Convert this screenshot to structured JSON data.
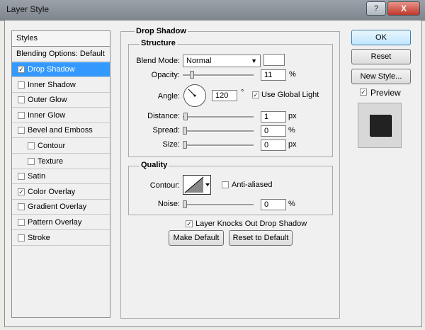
{
  "window": {
    "title": "Layer Style",
    "help_button": "?",
    "close_button": "X"
  },
  "styles": {
    "header": "Styles",
    "blending_options": "Blending Options: Default",
    "items": [
      {
        "label": "Drop Shadow",
        "checked": true,
        "selected": true,
        "indent": false
      },
      {
        "label": "Inner Shadow",
        "checked": false,
        "selected": false,
        "indent": false
      },
      {
        "label": "Outer Glow",
        "checked": false,
        "selected": false,
        "indent": false
      },
      {
        "label": "Inner Glow",
        "checked": false,
        "selected": false,
        "indent": false
      },
      {
        "label": "Bevel and Emboss",
        "checked": false,
        "selected": false,
        "indent": false
      },
      {
        "label": "Contour",
        "checked": false,
        "selected": false,
        "indent": true
      },
      {
        "label": "Texture",
        "checked": false,
        "selected": false,
        "indent": true
      },
      {
        "label": "Satin",
        "checked": false,
        "selected": false,
        "indent": false
      },
      {
        "label": "Color Overlay",
        "checked": true,
        "selected": false,
        "indent": false
      },
      {
        "label": "Gradient Overlay",
        "checked": false,
        "selected": false,
        "indent": false
      },
      {
        "label": "Pattern Overlay",
        "checked": false,
        "selected": false,
        "indent": false
      },
      {
        "label": "Stroke",
        "checked": false,
        "selected": false,
        "indent": false
      }
    ]
  },
  "drop_shadow": {
    "title": "Drop Shadow",
    "structure": {
      "title": "Structure",
      "blend_mode_label": "Blend Mode:",
      "blend_mode_value": "Normal",
      "opacity_label": "Opacity:",
      "opacity_value": "11",
      "opacity_unit": "%",
      "angle_label": "Angle:",
      "angle_value": "120",
      "angle_unit": "°",
      "use_global_light_label": "Use Global Light",
      "use_global_light_checked": true,
      "distance_label": "Distance:",
      "distance_value": "1",
      "distance_unit": "px",
      "spread_label": "Spread:",
      "spread_value": "0",
      "spread_unit": "%",
      "size_label": "Size:",
      "size_value": "0",
      "size_unit": "px"
    },
    "quality": {
      "title": "Quality",
      "contour_label": "Contour:",
      "anti_aliased_label": "Anti-aliased",
      "anti_aliased_checked": false,
      "noise_label": "Noise:",
      "noise_value": "0",
      "noise_unit": "%"
    },
    "knockout_label": "Layer Knocks Out Drop Shadow",
    "knockout_checked": true,
    "make_default_label": "Make Default",
    "reset_default_label": "Reset to Default"
  },
  "buttons": {
    "ok": "OK",
    "reset": "Reset",
    "new_style": "New Style...",
    "preview_label": "Preview",
    "preview_checked": true
  },
  "colors": {
    "selection": "#3399ff",
    "preview_swatch": "#222222",
    "shadow_color": "#ffffff"
  }
}
